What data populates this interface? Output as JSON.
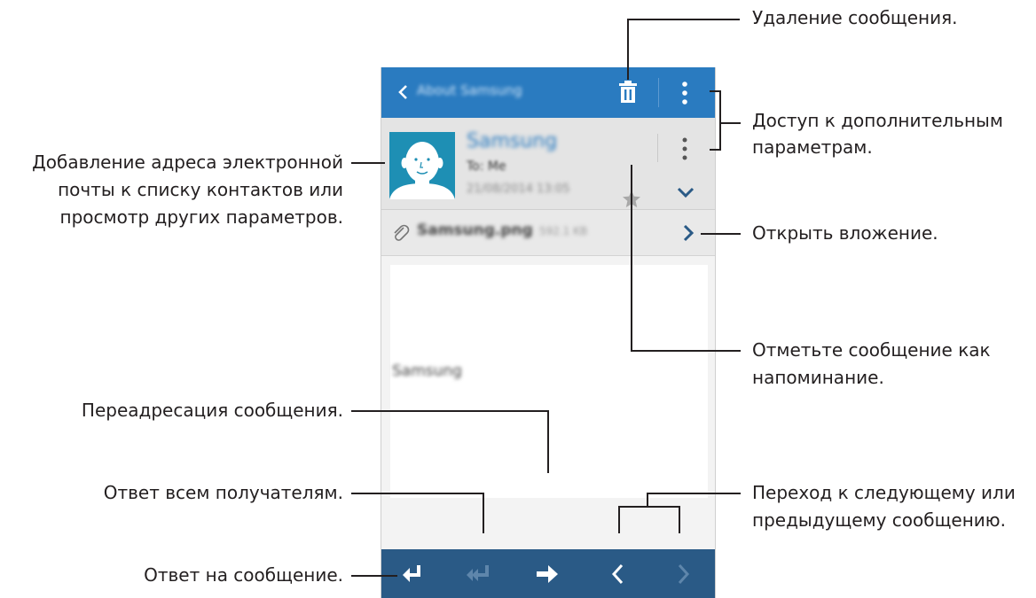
{
  "email_screen": {
    "subject": "About Samsung",
    "sender_name": "Samsung",
    "recipient": "To: Me",
    "date": "21/08/2014 13:05",
    "attachment_name": "Samsung.png",
    "attachment_size": "592.1 KB",
    "body_text": "Samsung"
  },
  "callouts": {
    "delete": "Удаление сообщения.",
    "more_options_1": "Доступ к дополнительным",
    "more_options_2": "параметрам.",
    "add_contact_1": "Добавление адреса электронной",
    "add_contact_2": "почты к списку контактов или",
    "add_contact_3": "просмотр других параметров.",
    "open_attachment": "Открыть вложение.",
    "mark_reminder_1": "Отметьте сообщение как",
    "mark_reminder_2": "напоминание.",
    "forward": "Переадресация сообщения.",
    "reply_all": "Ответ всем получателям.",
    "next_prev_1": "Переход к следующему или",
    "next_prev_2": "предыдущему сообщению.",
    "reply": "Ответ на сообщение."
  },
  "colors": {
    "topbar": "#2a7bc0",
    "bottombar": "#2a5a86",
    "avatar": "#1e8fb4"
  }
}
